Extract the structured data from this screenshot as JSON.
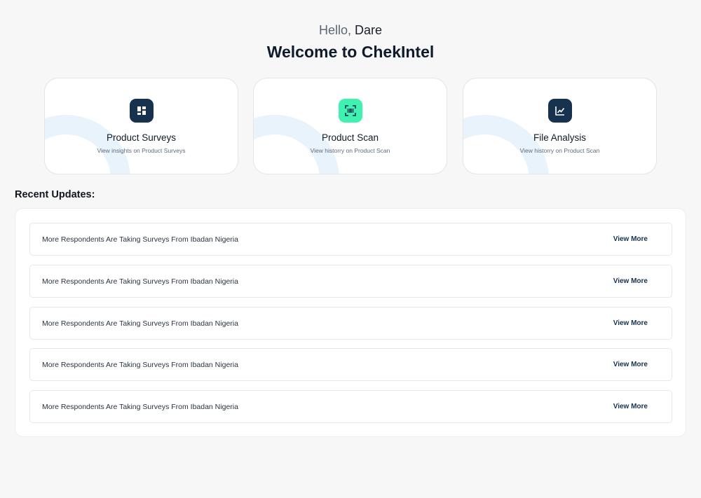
{
  "greeting": {
    "hello": "Hello,",
    "name": "Dare"
  },
  "welcome": "Welcome to ChekIntel",
  "cards": [
    {
      "title": "Product Surveys",
      "subtitle": "View insights on Product Surveys",
      "icon": "dashboard-icon",
      "icon_bg": "#17324f"
    },
    {
      "title": "Product Scan",
      "subtitle": "View historry on Product Scan",
      "icon": "scan-icon",
      "icon_bg": "#3ff2b0"
    },
    {
      "title": "File Analysis",
      "subtitle": "View historry on Product Scan",
      "icon": "chart-line-icon",
      "icon_bg": "#17324f"
    }
  ],
  "recent": {
    "title": "Recent Updates:",
    "items": [
      {
        "text": "More Respondents Are Taking Surveys From Ibadan Nigeria",
        "link": "View More"
      },
      {
        "text": "More Respondents Are Taking Surveys From Ibadan Nigeria",
        "link": "View More"
      },
      {
        "text": "More Respondents Are Taking Surveys From Ibadan Nigeria",
        "link": "View More"
      },
      {
        "text": "More Respondents Are Taking Surveys From Ibadan Nigeria",
        "link": "View More"
      },
      {
        "text": "More Respondents Are Taking Surveys From Ibadan Nigeria",
        "link": "View More"
      }
    ]
  },
  "colors": {
    "accent_dark": "#17324f",
    "accent_green": "#3ff2b0",
    "background": "#f7f7f7",
    "decor": "#e8f3fc"
  }
}
